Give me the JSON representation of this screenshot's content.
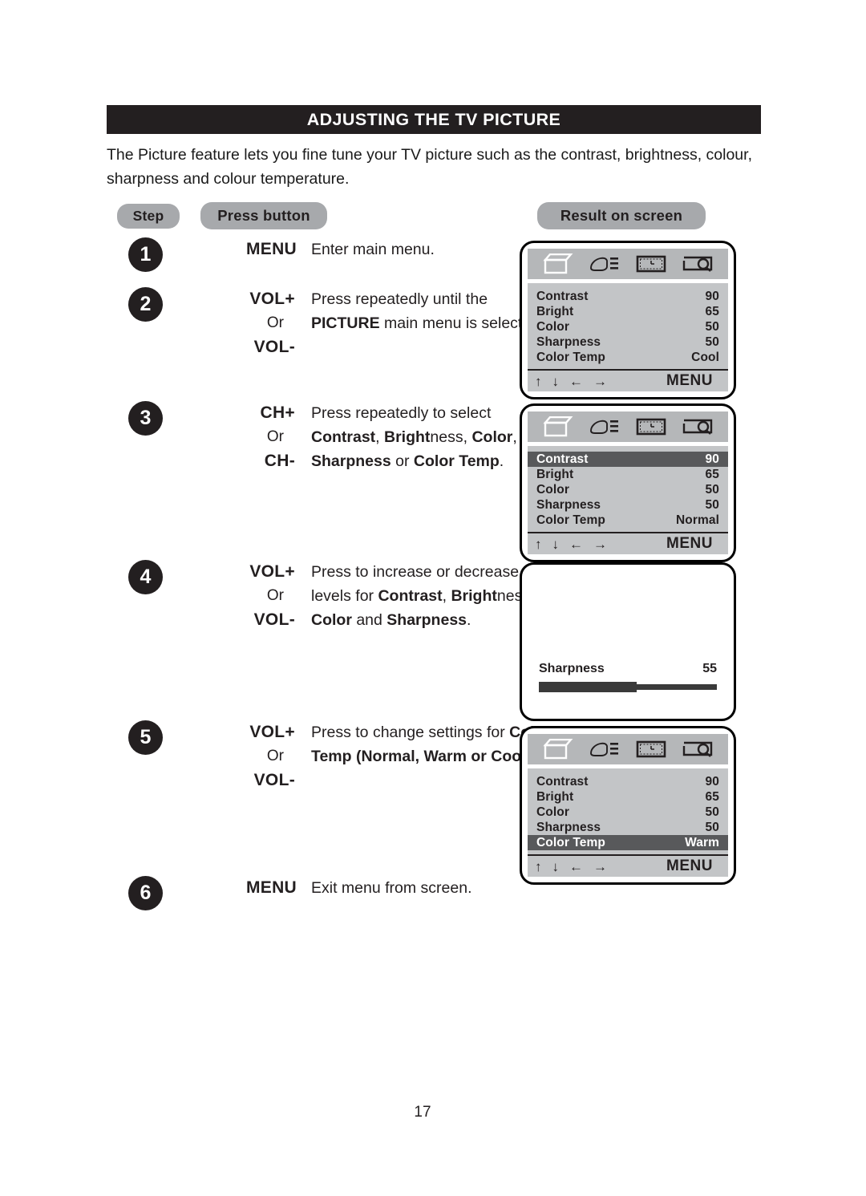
{
  "document": {
    "title": "ADJUSTING THE TV PICTURE",
    "intro": "The Picture feature lets you fine tune your TV picture such as the contrast, brightness, colour, sharpness and colour temperature.",
    "page_number": "17"
  },
  "headers": {
    "step": "Step",
    "press_button": "Press button",
    "result_on_screen": "Result on screen"
  },
  "steps": [
    {
      "number": "1",
      "buttons": [
        "MENU"
      ],
      "or": "",
      "desc_html": "Enter main menu."
    },
    {
      "number": "2",
      "buttons": [
        "VOL+",
        "VOL-"
      ],
      "or": "Or",
      "desc_html": "Press repeatedly until the <b>PICTURE</b> main menu is selected."
    },
    {
      "number": "3",
      "buttons": [
        "CH+",
        "CH-"
      ],
      "or": "Or",
      "desc_html": "Press repeatedly to select <b>Contrast</b>, <b>Bright</b>ness, <b>Color</b>, <b>Sharpness</b> or <b>Color Temp</b>."
    },
    {
      "number": "4",
      "buttons": [
        "VOL+",
        "VOL-"
      ],
      "or": "Or",
      "desc_html": "Press to increase or decrease levels for <b>Contrast</b>, <b>Bright</b>ness, <b>Color</b> and <b>Sharpness</b>."
    },
    {
      "number": "5",
      "buttons": [
        "VOL+",
        "VOL-"
      ],
      "or": "Or",
      "desc_html": "Press to change settings for <b>Color Temp (Normal, Warm or Cool)</b>"
    },
    {
      "number": "6",
      "buttons": [
        "MENU"
      ],
      "or": "",
      "desc_html": "Exit menu from screen."
    }
  ],
  "osd_icons": [
    {
      "name": "picture-tv-icon",
      "label": "Picture"
    },
    {
      "name": "hand-sound-icon",
      "label": "Sound"
    },
    {
      "name": "timer-frame-icon",
      "label": "Timer"
    },
    {
      "name": "screen-zoom-icon",
      "label": "Feature"
    }
  ],
  "osd_nav": {
    "arrows": [
      "↑",
      "↓",
      "←",
      "→"
    ],
    "menu_label": "MENU"
  },
  "screens": [
    {
      "id": "screen-step1",
      "type": "menu",
      "rows": [
        {
          "label": "Contrast",
          "value": "90",
          "selected": false
        },
        {
          "label": "Bright",
          "value": "65",
          "selected": false
        },
        {
          "label": "Color",
          "value": "50",
          "selected": false
        },
        {
          "label": "Sharpness",
          "value": "50",
          "selected": false
        },
        {
          "label": "Color Temp",
          "value": "Cool",
          "selected": false
        }
      ]
    },
    {
      "id": "screen-step3",
      "type": "menu",
      "rows": [
        {
          "label": "Contrast",
          "value": "90",
          "selected": true
        },
        {
          "label": "Bright",
          "value": "65",
          "selected": false
        },
        {
          "label": "Color",
          "value": "50",
          "selected": false
        },
        {
          "label": "Sharpness",
          "value": "50",
          "selected": false
        },
        {
          "label": "Color Temp",
          "value": "Normal",
          "selected": false
        }
      ]
    },
    {
      "id": "screen-step4",
      "type": "slider",
      "slider": {
        "label": "Sharpness",
        "value": "55",
        "percent": 55
      }
    },
    {
      "id": "screen-step5",
      "type": "menu",
      "rows": [
        {
          "label": "Contrast",
          "value": "90",
          "selected": false
        },
        {
          "label": "Bright",
          "value": "65",
          "selected": false
        },
        {
          "label": "Color",
          "value": "50",
          "selected": false
        },
        {
          "label": "Sharpness",
          "value": "50",
          "selected": false
        },
        {
          "label": "Color Temp",
          "value": "Warm",
          "selected": true
        }
      ]
    }
  ],
  "colors": {
    "title_bar_bg": "#231f20",
    "pill_bg": "#a7a9ac",
    "osd_iconbar_bg": "#b5b7b9",
    "osd_body_bg": "#c3c5c7",
    "osd_selected_bg": "#58595b",
    "bar_fill": "#3a3a3a"
  }
}
